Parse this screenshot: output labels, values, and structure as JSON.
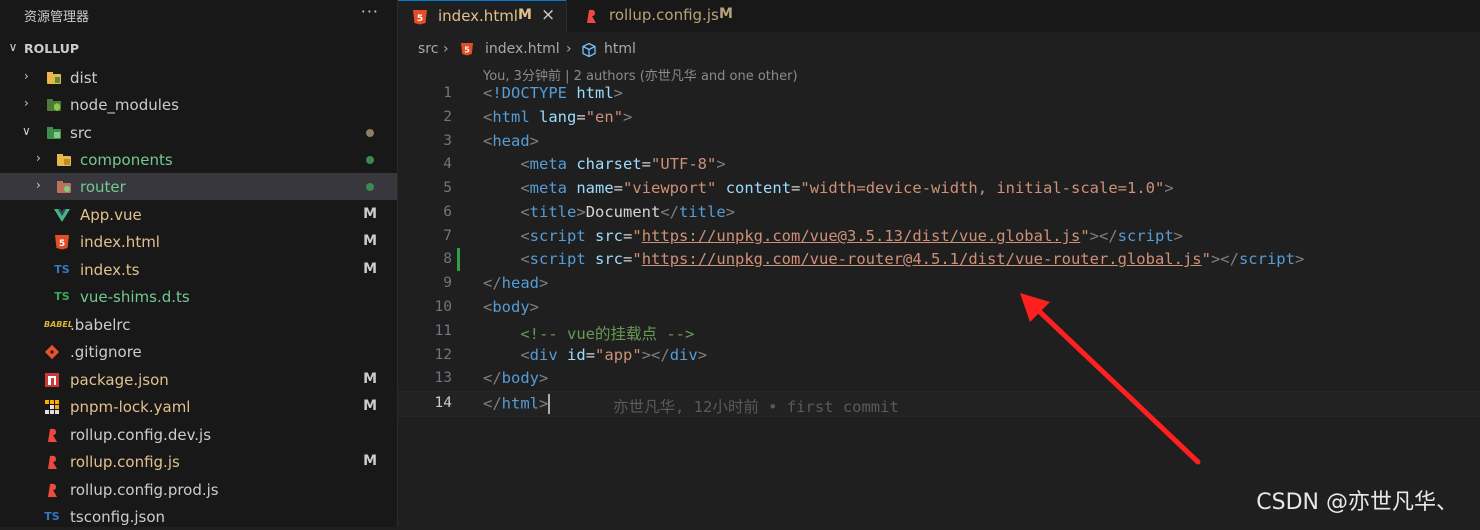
{
  "explorer": {
    "title": "资源管理器",
    "more": "···",
    "section": "ROLLUP",
    "items": [
      {
        "name": "dist",
        "color": "#cccccc"
      },
      {
        "name": "node_modules",
        "color": "#cccccc"
      },
      {
        "name": "src",
        "color": "#cccccc"
      },
      {
        "name": "components",
        "color": "#73c991"
      },
      {
        "name": "router",
        "color": "#73c991"
      },
      {
        "name": "App.vue",
        "badge": "M",
        "color": "#e2c08d"
      },
      {
        "name": "index.html",
        "badge": "M",
        "color": "#e2c08d"
      },
      {
        "name": "index.ts",
        "badge": "M",
        "color": "#e2c08d"
      },
      {
        "name": "vue-shims.d.ts",
        "color": "#73c991"
      },
      {
        "name": ".babelrc",
        "color": "#cccccc"
      },
      {
        "name": ".gitignore",
        "color": "#cccccc"
      },
      {
        "name": "package.json",
        "badge": "M",
        "color": "#e2c08d"
      },
      {
        "name": "pnpm-lock.yaml",
        "badge": "M",
        "color": "#e2c08d"
      },
      {
        "name": "rollup.config.dev.js",
        "color": "#cccccc"
      },
      {
        "name": "rollup.config.js",
        "badge": "M",
        "color": "#e2c08d"
      },
      {
        "name": "rollup.config.prod.js",
        "color": "#cccccc"
      },
      {
        "name": "tsconfig.json",
        "color": "#cccccc"
      }
    ]
  },
  "tabs": [
    {
      "label": "index.html",
      "modified": "M",
      "close": "×",
      "active": true
    },
    {
      "label": "rollup.config.js",
      "modified": "M",
      "active": false
    }
  ],
  "breadcrumb": {
    "folder": "src",
    "file": "index.html",
    "symbol": "html"
  },
  "blame_header": "You, 3分钟前 | 2 authors (亦世凡华 and one other)",
  "lines": [
    "1",
    "2",
    "3",
    "4",
    "5",
    "6",
    "7",
    "8",
    "9",
    "10",
    "11",
    "12",
    "13",
    "14"
  ],
  "code": {
    "doctype_kw": "!DOCTYPE",
    "doctype_val": "html",
    "lang": "en",
    "charset": "UTF-8",
    "viewport": "viewport",
    "content": "width=device-width, initial-scale=1.0",
    "title": "Document",
    "script1": "https://unpkg.com/vue@3.5.13/dist/vue.global.js",
    "script2": "https://unpkg.com/vue-router@4.5.1/dist/vue-router.global.js",
    "comment": "vue的挂载点",
    "app_id": "app"
  },
  "inline_blame": "亦世凡华, 12小时前 • first commit",
  "watermark": "CSDN @亦世凡华、",
  "colors": {
    "arrow": "#ff1f1f",
    "accent": "#0078d4",
    "modified": "#e2c08d",
    "untracked": "#73c991"
  }
}
